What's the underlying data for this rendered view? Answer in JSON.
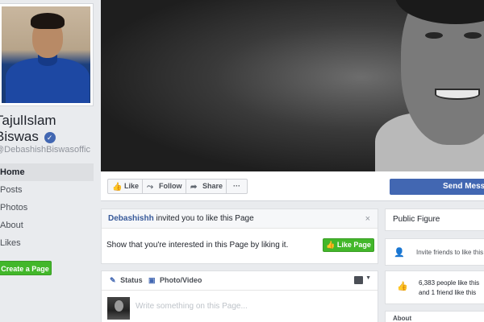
{
  "profile": {
    "name": "TajulIslam Biswas",
    "handle": "@DebashishBiswasofficial"
  },
  "left_nav": {
    "items": [
      {
        "label": "Home",
        "active": true
      },
      {
        "label": "Posts"
      },
      {
        "label": "Photos"
      },
      {
        "label": "About"
      },
      {
        "label": "Likes"
      }
    ],
    "create_page": "Create a Page"
  },
  "action_bar": {
    "like": "Like",
    "follow": "Follow",
    "share": "Share",
    "more": "···",
    "send_message": "Send Message"
  },
  "invite": {
    "inviter": "Debashishh",
    "text": "invited you to like this Page",
    "body": "Show that you're interested in this Page by liking it.",
    "button": "Like Page"
  },
  "composer": {
    "status_tab": "Status",
    "photo_tab": "Photo/Video",
    "placeholder": "Write something on this Page..."
  },
  "sidebar": {
    "category": "Public Figure",
    "invite_friends": "Invite friends to like this Page",
    "likes_text": "6,383 people like this and 1 friend like this",
    "about": "About"
  },
  "colors": {
    "brand_blue": "#4267b2",
    "green": "#42b72a",
    "link": "#365899"
  }
}
